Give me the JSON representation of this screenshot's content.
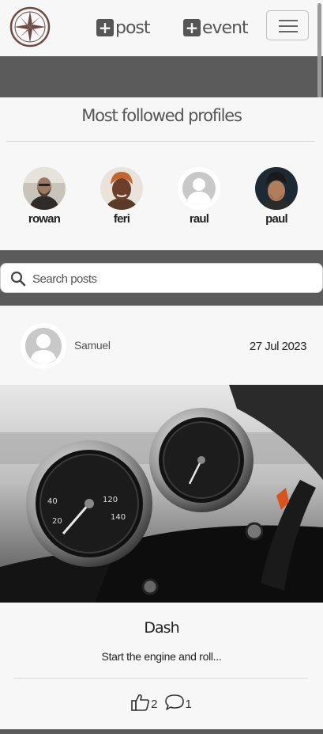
{
  "navbar": {
    "logo_icon": "compass-icon",
    "post_label": "post",
    "event_label": "event",
    "menu_icon": "hamburger-menu-icon"
  },
  "profiles": {
    "title": "Most followed profiles",
    "items": [
      {
        "name": "rowan",
        "avatar": "photo"
      },
      {
        "name": "feri",
        "avatar": "photo"
      },
      {
        "name": "raul",
        "avatar": "default-avatar-icon"
      },
      {
        "name": "paul",
        "avatar": "photo"
      }
    ]
  },
  "search": {
    "placeholder": "Search posts",
    "value": ""
  },
  "post": {
    "author": "Samuel",
    "date": "27 Jul 2023",
    "image": "motorcycle-dashboard-photo",
    "title": "Dash",
    "excerpt": "Start the engine and roll...",
    "likes": "2",
    "comments": "1"
  },
  "colors": {
    "page_background": "#5b5b5b",
    "card_background": "#f7f7f7",
    "text_dark": "#222222",
    "text_muted": "#555555"
  }
}
